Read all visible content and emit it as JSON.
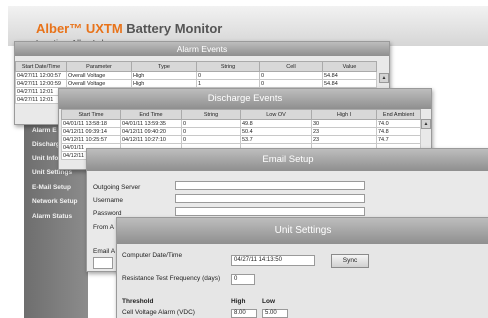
{
  "app": {
    "brand_name": "Alber™ UXTM",
    "brand_title": " Battery Monitor",
    "location": "Location: Alber Lab"
  },
  "nav": {
    "items": [
      "Alarm E",
      "Discharge",
      "Unit Info",
      "Unit Settings",
      "E-Mail Setup",
      "Network Setup",
      "Alarm Status"
    ]
  },
  "alarm_events": {
    "title": "Alarm Events",
    "columns": [
      "Start Date/Time",
      "Parameter",
      "Type",
      "String",
      "Cell",
      "Value"
    ],
    "rows": [
      [
        "04/27/11 12:00:57",
        "Overall Voltage",
        "High",
        "0",
        "0",
        "54.84"
      ],
      [
        "04/27/11 12:00:59",
        "Overall Voltage",
        "High",
        "1",
        "0",
        "54.84"
      ],
      [
        "04/27/11 12:01",
        "",
        "",
        "",
        "",
        ""
      ],
      [
        "04/27/11 12:01",
        "",
        "",
        "",
        "",
        ""
      ]
    ]
  },
  "discharge_events": {
    "title": "Discharge Events",
    "columns": [
      "Start Time",
      "End Time",
      "String",
      "Low OV",
      "High I",
      "End Ambient"
    ],
    "rows": [
      [
        "04/01/11 13:58:18",
        "04/01/11 13:59:35",
        "0",
        "49.8",
        "30",
        "74.0"
      ],
      [
        "04/12/11 09:39:14",
        "04/12/11 09:40:20",
        "0",
        "50.4",
        "23",
        "74.8"
      ],
      [
        "04/12/11 10:25:57",
        "04/12/11 10:27:10",
        "0",
        "53.7",
        "23",
        "74.7"
      ],
      [
        "04/01/11",
        "",
        "",
        "",
        "",
        ""
      ],
      [
        "04/12/11",
        "",
        "",
        "",
        "",
        ""
      ]
    ]
  },
  "email_setup": {
    "title": "Email Setup",
    "fields": [
      "Outgoing Server",
      "Username",
      "Password",
      "From A"
    ],
    "extra_label": "Email A"
  },
  "unit_settings": {
    "title": "Unit Settings",
    "computer_datetime_label": "Computer Date/Time",
    "computer_datetime_value": "04/27/11 14:13:50",
    "sync_label": "Sync",
    "rt_freq_label": "Resistance Test Frequency (days)",
    "rt_freq_value": "0",
    "threshold_header": "Threshold",
    "high_header": "High",
    "low_header": "Low",
    "cell_voltage_label": "Cell Voltage Alarm (VDC)",
    "cell_voltage_high": "8.00",
    "cell_voltage_low": "5.00"
  }
}
